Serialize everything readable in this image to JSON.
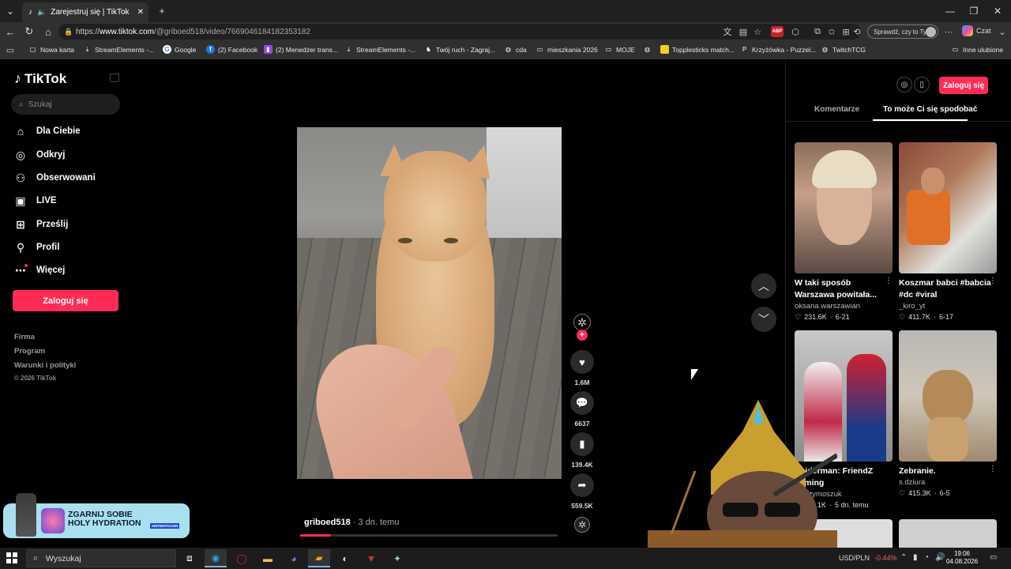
{
  "browser": {
    "tab_title": "Zarejestruj się | TikTok",
    "url_prefix": "https://",
    "url_host": "www.tiktok.com",
    "url_path": "/@griboed518/video/7669046184182353182",
    "search_web_label": "Sprawdź, czy to Ty",
    "chat_label": "Czat",
    "ext_badge": "ABP"
  },
  "bookmarks": [
    {
      "label": "Nowa karta",
      "icon": "new-tab-icon"
    },
    {
      "label": "StreamElements -...",
      "icon": "streamelements-icon"
    },
    {
      "label": "Google",
      "icon": "google-icon"
    },
    {
      "label": "(2) Facebook",
      "icon": "facebook-icon"
    },
    {
      "label": "(2) Menedżer trans...",
      "icon": "twitch-icon"
    },
    {
      "label": "StreamElements -...",
      "icon": "streamelements-icon"
    },
    {
      "label": "Twój ruch - Zagraj...",
      "icon": "chess-icon"
    },
    {
      "label": "cda",
      "icon": "globe-icon"
    },
    {
      "label": "mieszkania 2026",
      "icon": "folder-icon"
    },
    {
      "label": "MOJE",
      "icon": "folder-icon"
    },
    {
      "label": "",
      "icon": "globe-icon"
    },
    {
      "label": "Topplesticks match...",
      "icon": "yellow-icon"
    },
    {
      "label": "Krzyżówka - Puzzel...",
      "icon": "p-icon"
    },
    {
      "label": "TwitchTCG",
      "icon": "globe-icon"
    }
  ],
  "bookmarks_other": "Inne ulubione",
  "sidebar": {
    "logo": "TikTok",
    "search_placeholder": "Szukaj",
    "nav": [
      {
        "label": "Dla Ciebie",
        "icon": "home-icon"
      },
      {
        "label": "Odkryj",
        "icon": "compass-icon"
      },
      {
        "label": "Obserwowani",
        "icon": "following-icon"
      },
      {
        "label": "LIVE",
        "icon": "live-icon"
      },
      {
        "label": "Prześlij",
        "icon": "upload-icon"
      },
      {
        "label": "Profil",
        "icon": "profile-icon"
      },
      {
        "label": "Więcej",
        "icon": "more-icon"
      }
    ],
    "login_button": "Zaloguj się",
    "footer": [
      "Firma",
      "Program",
      "Warunki i polityki"
    ],
    "copyright": "© 2026 TikTok"
  },
  "video": {
    "author": "griboed518",
    "posted": " · 3 dn. temu",
    "progress": 0.12,
    "likes": "1.6M",
    "comments": "6637",
    "saves": "139.4K",
    "shares": "559.5K"
  },
  "right_panel": {
    "login_button": "Zaloguj się",
    "tabs": [
      "Komentarze",
      "To może Ci się spodobać"
    ],
    "cards": [
      {
        "title": "W taki sposób Warszawa powitała...",
        "author": "oksana.warszawian",
        "likes": "231.6K",
        "date": "6-21"
      },
      {
        "title": "Koszmar babci #babcia #dc #viral",
        "author": "_kiro_yt",
        "likes": "411.7K",
        "date": "6-17"
      },
      {
        "title": "Spiderman: FriendZ coming",
        "author": "kiniatymoszuk",
        "likes": "112.1K",
        "date": "5 dn. temu"
      },
      {
        "title": "Zebranie.",
        "author": "s.dziura",
        "likes": "415.3K",
        "date": "6-5"
      }
    ]
  },
  "promo": {
    "headline_1": "ZGARNIJ SOBIE",
    "headline_2": "HOLY HYDRATION",
    "brand": "XINTENTACION"
  },
  "taskbar": {
    "search": "Wyszukaj",
    "ticker_pair": "USD/PLN",
    "ticker_change": "-0.44%",
    "time": "19:06",
    "date": "04.08.2026"
  }
}
